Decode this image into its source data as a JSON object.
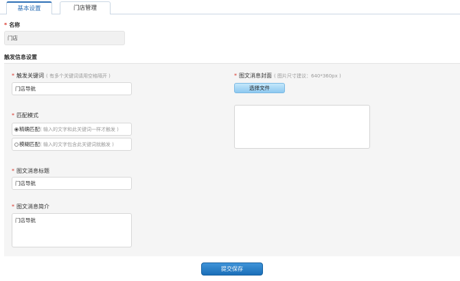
{
  "tabs": [
    {
      "label": "基本设置"
    },
    {
      "label": "门店管理"
    }
  ],
  "name": {
    "label": "名称",
    "value": "门店"
  },
  "trigger_section": {
    "title": "触发信息设置"
  },
  "keyword": {
    "label": "触发关键词",
    "hint": "( 有多个关键词请用空格隔开 )",
    "value": "门店导航"
  },
  "match_mode": {
    "label": "匹配模式",
    "options": [
      {
        "label": "精确匹配",
        "hint": "( 输入的文字和此关键词一样才触发 )",
        "checked": true
      },
      {
        "label": "模糊匹配",
        "hint": "( 输入的文字包含此关键词就触发 )",
        "checked": false
      }
    ]
  },
  "news_title": {
    "label": "图文消息标题",
    "value": "门店导航"
  },
  "news_intro": {
    "label": "图文消息简介",
    "value": "门店导航"
  },
  "cover": {
    "label": "图文消息封面",
    "hint": "( 图片尺寸建议：640*360px )",
    "button": "选择文件"
  },
  "submit": {
    "label": "提交保存"
  },
  "colors": {
    "required": "#d9372c",
    "accent": "#2a6db4",
    "submit": "#1a6fb8"
  }
}
